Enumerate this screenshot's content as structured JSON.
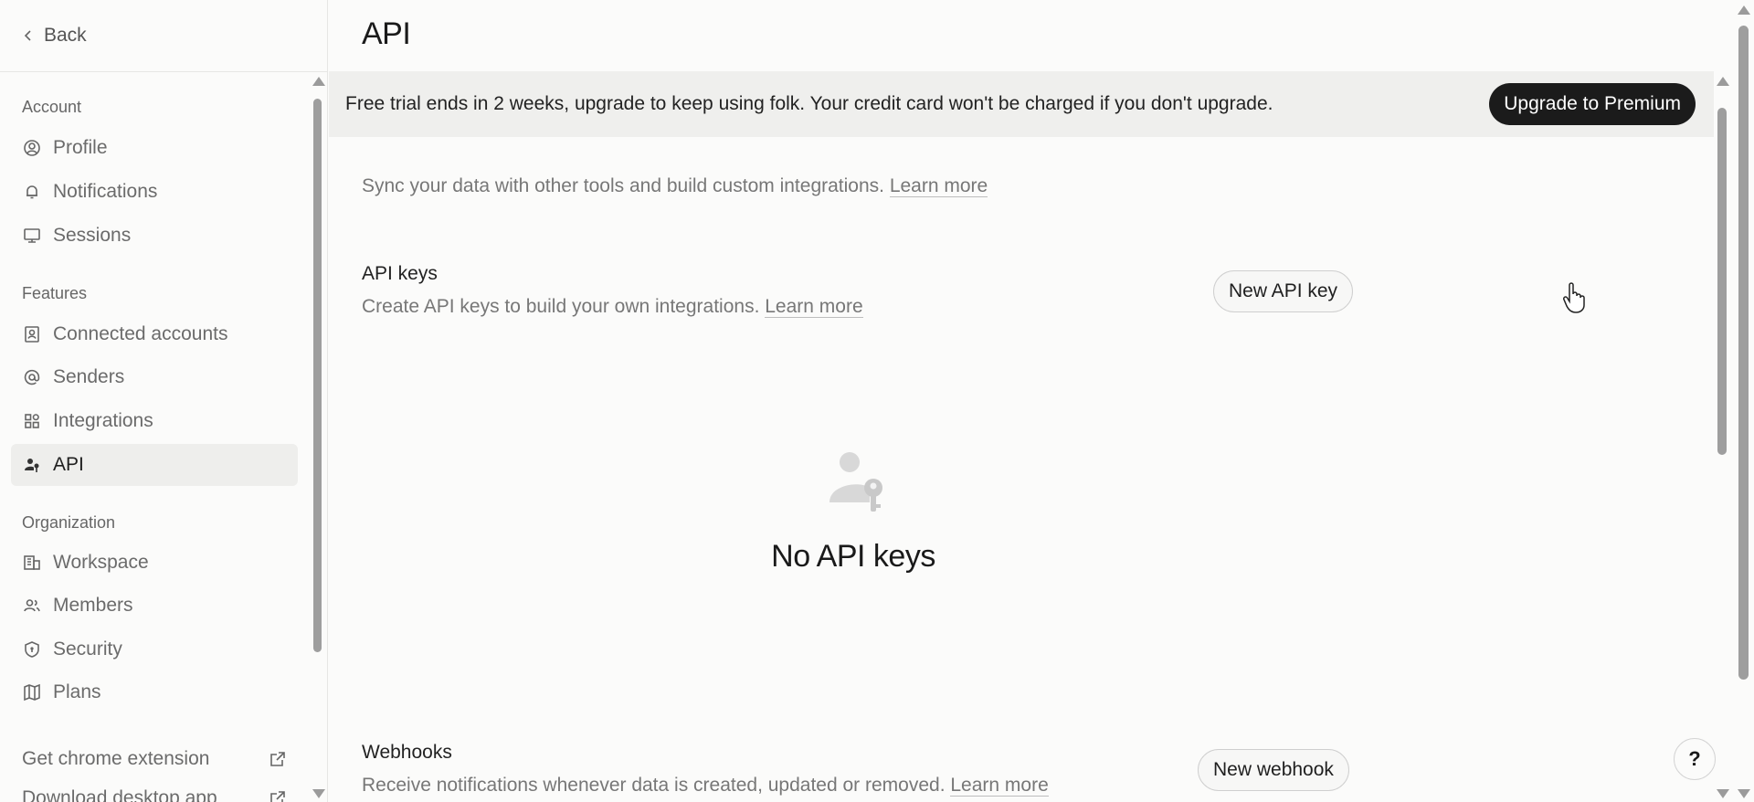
{
  "sidebar": {
    "back_label": "Back",
    "sections": {
      "account": "Account",
      "features": "Features",
      "organization": "Organization"
    },
    "items": [
      {
        "label": "Profile",
        "icon": "user-circle-icon"
      },
      {
        "label": "Notifications",
        "icon": "bell-icon"
      },
      {
        "label": "Sessions",
        "icon": "monitor-icon"
      },
      {
        "label": "Connected accounts",
        "icon": "id-card-icon"
      },
      {
        "label": "Senders",
        "icon": "at-sign-icon"
      },
      {
        "label": "Integrations",
        "icon": "apps-grid-icon"
      },
      {
        "label": "API",
        "icon": "user-key-icon",
        "active": true
      },
      {
        "label": "Workspace",
        "icon": "building-icon"
      },
      {
        "label": "Members",
        "icon": "users-icon"
      },
      {
        "label": "Security",
        "icon": "shield-icon"
      },
      {
        "label": "Plans",
        "icon": "map-icon"
      }
    ],
    "links": [
      {
        "label": "Get chrome extension",
        "icon": "external-link-icon"
      },
      {
        "label": "Download desktop app",
        "icon": "external-link-icon"
      }
    ]
  },
  "page": {
    "title": "API"
  },
  "banner": {
    "text": "Free trial ends in 2 weeks, upgrade to keep using folk. Your credit card won't be charged if you don't upgrade.",
    "button_label": "Upgrade to Premium"
  },
  "intro": {
    "text": "Sync your data with other tools and build custom integrations.",
    "link": "Learn more"
  },
  "api_keys": {
    "title": "API keys",
    "description": "Create API keys to build your own integrations.",
    "link": "Learn more",
    "button_label": "New API key",
    "empty_title": "No API keys",
    "empty_icon": "user-key-icon"
  },
  "webhooks": {
    "title": "Webhooks",
    "description": "Receive notifications whenever data is created, updated or removed.",
    "link": "Learn more",
    "button_label": "New webhook"
  },
  "help": {
    "label": "?"
  }
}
